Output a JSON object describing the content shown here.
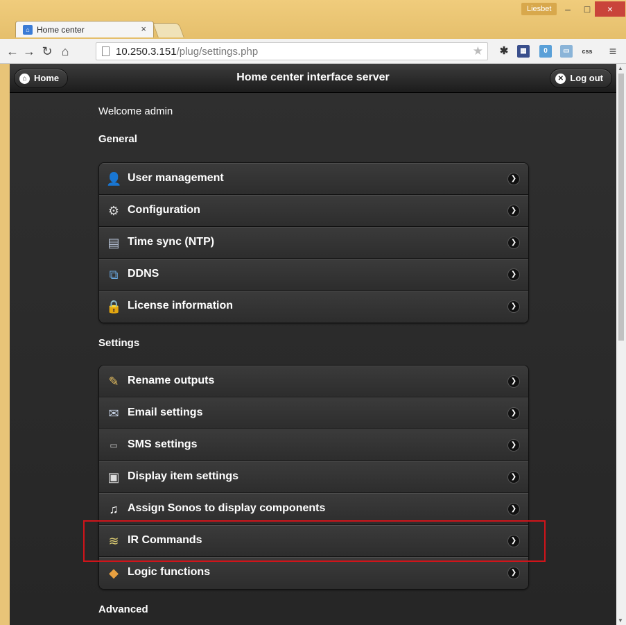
{
  "browser": {
    "tab_title": "Home center",
    "tab_close": "×",
    "profile_name": "Liesbet",
    "url_host": "10.250.3.151",
    "url_path": "/plug/settings.php",
    "win_min": "–",
    "win_max": "□",
    "win_close": "×"
  },
  "header": {
    "home_label": "Home",
    "title": "Home center interface server",
    "logout_label": "Log out"
  },
  "page": {
    "welcome": "Welcome admin",
    "general_title": "General",
    "settings_title": "Settings",
    "advanced_title": "Advanced",
    "general_items": [
      {
        "label": "User management",
        "icon": "user-management-icon"
      },
      {
        "label": "Configuration",
        "icon": "gear-icon"
      },
      {
        "label": "Time sync (NTP)",
        "icon": "clock-server-icon"
      },
      {
        "label": "DDNS",
        "icon": "network-icon"
      },
      {
        "label": "License information",
        "icon": "license-icon"
      }
    ],
    "settings_items": [
      {
        "label": "Rename outputs",
        "icon": "brush-icon"
      },
      {
        "label": "Email settings",
        "icon": "envelope-icon"
      },
      {
        "label": "SMS settings",
        "icon": "sms-icon"
      },
      {
        "label": "Display item settings",
        "icon": "display-icon"
      },
      {
        "label": "Assign Sonos to display components",
        "icon": "music-note-icon"
      },
      {
        "label": "IR Commands",
        "icon": "ir-icon"
      },
      {
        "label": "Logic functions",
        "icon": "logic-icon"
      }
    ]
  }
}
